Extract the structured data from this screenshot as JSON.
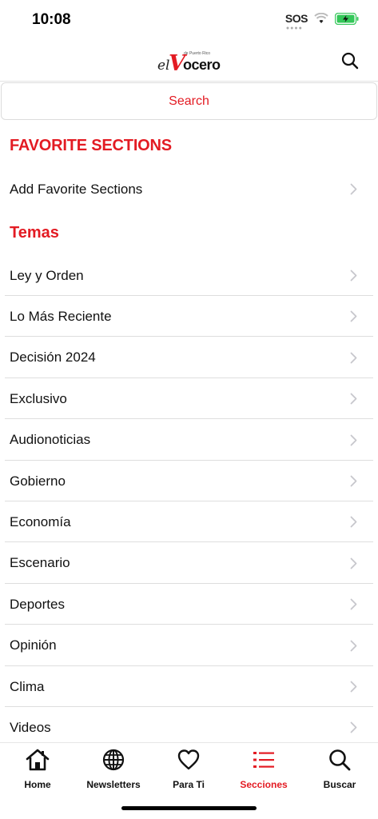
{
  "status": {
    "time": "10:08",
    "sos": "SOS"
  },
  "header": {
    "logo_prefix": "el",
    "logo_v": "V",
    "logo_rest": "ocero",
    "logo_small": "de Puerto Rico"
  },
  "search": {
    "label": "Search"
  },
  "favorites": {
    "heading": "FAVORITE SECTIONS",
    "add_label": "Add Favorite Sections"
  },
  "temas": {
    "heading": "Temas",
    "items": [
      "Ley y Orden",
      "Lo Más Reciente",
      "Decisión 2024",
      "Exclusivo",
      "Audionoticias",
      "Gobierno",
      "Economía",
      "Escenario",
      "Deportes",
      "Opinión",
      "Clima",
      "Videos"
    ]
  },
  "tabs": [
    {
      "label": "Home",
      "icon": "home-icon"
    },
    {
      "label": "Newsletters",
      "icon": "globe-icon"
    },
    {
      "label": "Para Ti",
      "icon": "heart-icon"
    },
    {
      "label": "Secciones",
      "icon": "list-icon"
    },
    {
      "label": "Buscar",
      "icon": "search-icon"
    }
  ],
  "colors": {
    "accent": "#e31b23",
    "battery": "#34c759"
  }
}
